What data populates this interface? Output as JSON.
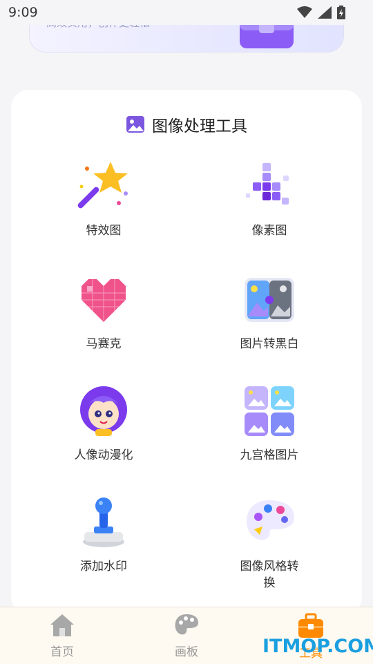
{
  "status_bar": {
    "time": "9:09"
  },
  "banner": {
    "subtitle": "高效实用，创作更轻松"
  },
  "tools_section": {
    "title": "图像处理工具",
    "items": [
      {
        "label": "特效图",
        "icon": "magic-wand-star-icon"
      },
      {
        "label": "像素图",
        "icon": "pixel-cubes-icon"
      },
      {
        "label": "马赛克",
        "icon": "pixel-heart-icon"
      },
      {
        "label": "图片转黑白",
        "icon": "color-to-bw-icon"
      },
      {
        "label": "人像动漫化",
        "icon": "anime-portrait-icon"
      },
      {
        "label": "九宫格图片",
        "icon": "grid-images-icon"
      },
      {
        "label": "添加水印",
        "icon": "stamp-icon"
      },
      {
        "label": "图像风格转换",
        "icon": "palette-icon"
      }
    ]
  },
  "tabbar": {
    "tabs": [
      {
        "label": "首页",
        "icon": "home-icon"
      },
      {
        "label": "画板",
        "icon": "palette-tab-icon"
      },
      {
        "label": "工具",
        "icon": "toolbox-icon",
        "active": true
      }
    ]
  },
  "watermark": "ITMOP.COM",
  "colors": {
    "accent": "#ff8a00",
    "tab_inactive": "#999999",
    "watermark": "#1a9fe0"
  }
}
